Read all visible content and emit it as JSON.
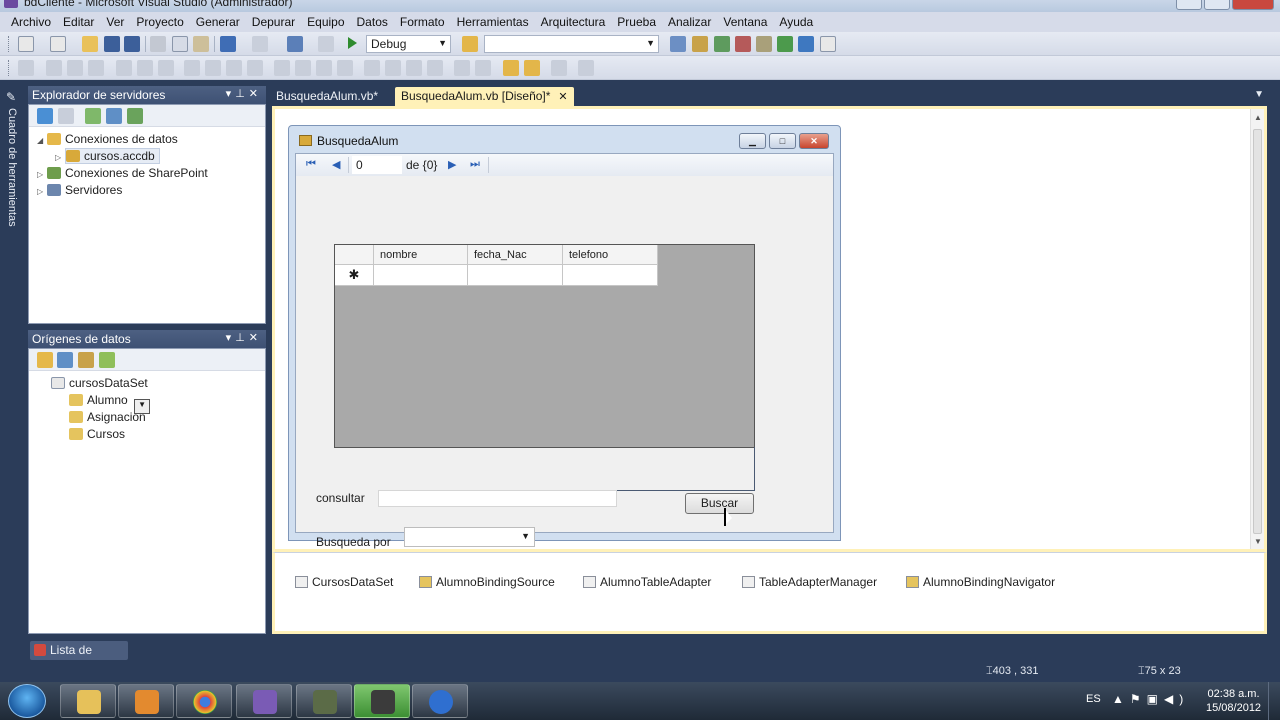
{
  "window": {
    "title": "bdCliente - Microsoft Visual Studio (Administrador)"
  },
  "menu": [
    "Archivo",
    "Editar",
    "Ver",
    "Proyecto",
    "Generar",
    "Depurar",
    "Equipo",
    "Datos",
    "Formato",
    "Herramientas",
    "Arquitectura",
    "Prueba",
    "Analizar",
    "Ventana",
    "Ayuda"
  ],
  "toolbar": {
    "config": "Debug",
    "platform": ""
  },
  "left_strip": {
    "label": "Cuadro de herramientas"
  },
  "server_explorer": {
    "title": "Explorador de servidores",
    "items": [
      {
        "label": "Conexiones de datos"
      },
      {
        "label": "cursos.accdb"
      },
      {
        "label": "Conexiones de SharePoint"
      },
      {
        "label": "Servidores"
      }
    ]
  },
  "data_sources": {
    "title": "Orígenes de datos",
    "items": [
      {
        "label": "cursosDataSet"
      },
      {
        "label": "Alumno"
      },
      {
        "label": "Asignacion"
      },
      {
        "label": "Cursos"
      }
    ]
  },
  "tabs": [
    {
      "label": "BusquedaAlum.vb*"
    },
    {
      "label": "BusquedaAlum.vb [Diseño]*"
    }
  ],
  "form": {
    "title": "BusquedaAlum",
    "navigator": {
      "position": "0",
      "of": "de {0}"
    },
    "grid": {
      "columns": [
        "nombre",
        "fecha_Nac",
        "telefono"
      ],
      "new_row_marker": "✱"
    },
    "consultar_label": "consultar",
    "consultar_value": "",
    "buscar_button": "Buscar",
    "busqueda_label": "Busqueda por",
    "busqueda_value": ""
  },
  "component_tray": [
    {
      "label": "CursosDataSet"
    },
    {
      "label": "AlumnoBindingSource"
    },
    {
      "label": "AlumnoTableAdapter"
    },
    {
      "label": "TableAdapterManager"
    },
    {
      "label": "AlumnoBindingNavigator"
    }
  ],
  "error_list": {
    "label": "Lista de errores"
  },
  "status": {
    "position": "403 , 331",
    "size": "75 x 23"
  },
  "taskbar": {
    "lang": "ES",
    "time": "02:38 a.m.",
    "date": "15/08/2012"
  }
}
